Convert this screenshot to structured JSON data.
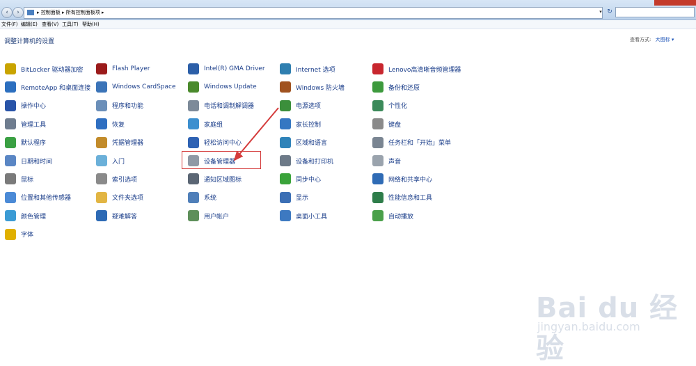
{
  "window": {
    "breadcrumb": [
      "控制面板",
      "所有控制面板项"
    ],
    "search_placeholder": "",
    "menu": [
      "文件(F)",
      "编辑(E)",
      "查看(V)",
      "工具(T)",
      "帮助(H)"
    ]
  },
  "page": {
    "heading": "调整计算机的设置",
    "view_label": "查看方式:",
    "view_value": "大图标 ▾"
  },
  "columns": [
    [
      {
        "label": "BitLocker 驱动器加密",
        "icon": "bitlocker-key-icon",
        "color": "#c9a400"
      },
      {
        "label": "RemoteApp 和桌面连接",
        "icon": "remoteapp-icon",
        "color": "#2c6fbf"
      },
      {
        "label": "操作中心",
        "icon": "action-center-flag-icon",
        "color": "#2954a8"
      },
      {
        "label": "管理工具",
        "icon": "admin-tools-icon",
        "color": "#6f7d8f"
      },
      {
        "label": "默认程序",
        "icon": "default-programs-icon",
        "color": "#3aa043"
      },
      {
        "label": "日期和时间",
        "icon": "clock-icon",
        "color": "#5a86c4"
      },
      {
        "label": "鼠标",
        "icon": "mouse-icon",
        "color": "#7a7a7a"
      },
      {
        "label": "位置和其他传感器",
        "icon": "sensor-icon",
        "color": "#4b8ad6"
      },
      {
        "label": "颜色管理",
        "icon": "color-management-icon",
        "color": "#3b9bd4"
      },
      {
        "label": "字体",
        "icon": "fonts-icon",
        "color": "#e0b000"
      }
    ],
    [
      {
        "label": "Flash Player",
        "icon": "flash-player-icon",
        "color": "#9b1b1b"
      },
      {
        "label": "Windows CardSpace",
        "icon": "cardspace-icon",
        "color": "#3b74b8"
      },
      {
        "label": "程序和功能",
        "icon": "programs-features-icon",
        "color": "#6b8fb9"
      },
      {
        "label": "恢复",
        "icon": "recovery-icon",
        "color": "#2f6fc1"
      },
      {
        "label": "凭据管理器",
        "icon": "credential-manager-icon",
        "color": "#c28b2a"
      },
      {
        "label": "入门",
        "icon": "getting-started-icon",
        "color": "#6bb0d9"
      },
      {
        "label": "索引选项",
        "icon": "indexing-icon",
        "color": "#8a8a8a"
      },
      {
        "label": "文件夹选项",
        "icon": "folder-options-icon",
        "color": "#e2b543"
      },
      {
        "label": "疑难解答",
        "icon": "troubleshooting-icon",
        "color": "#2d6ab5"
      }
    ],
    [
      {
        "label": "Intel(R) GMA Driver",
        "icon": "intel-gma-icon",
        "color": "#2c5fa8"
      },
      {
        "label": "Windows Update",
        "icon": "windows-update-icon",
        "color": "#4a8a2c"
      },
      {
        "label": "电话和调制解调器",
        "icon": "phone-modem-icon",
        "color": "#7d8a99"
      },
      {
        "label": "家庭组",
        "icon": "homegroup-icon",
        "color": "#3c8fcf"
      },
      {
        "label": "轻松访问中心",
        "icon": "ease-of-access-icon",
        "color": "#2e62b3"
      },
      {
        "label": "设备管理器",
        "icon": "device-manager-icon",
        "color": "#8f99a6"
      },
      {
        "label": "通知区域图标",
        "icon": "notification-area-icon",
        "color": "#5b6674"
      },
      {
        "label": "系统",
        "icon": "system-icon",
        "color": "#4f7fb9"
      },
      {
        "label": "用户帐户",
        "icon": "user-accounts-icon",
        "color": "#5e8f5a"
      }
    ],
    [
      {
        "label": "Internet 选项",
        "icon": "internet-options-icon",
        "color": "#2f7fb0"
      },
      {
        "label": "Windows 防火墙",
        "icon": "firewall-icon",
        "color": "#a0521f"
      },
      {
        "label": "电源选项",
        "icon": "power-options-icon",
        "color": "#3b8f3b"
      },
      {
        "label": "家长控制",
        "icon": "parental-controls-icon",
        "color": "#3577c2"
      },
      {
        "label": "区域和语言",
        "icon": "region-language-icon",
        "color": "#2f83b9"
      },
      {
        "label": "设备和打印机",
        "icon": "devices-printers-icon",
        "color": "#6d7a88"
      },
      {
        "label": "同步中心",
        "icon": "sync-center-icon",
        "color": "#3aa33a"
      },
      {
        "label": "显示",
        "icon": "display-icon",
        "color": "#3b6fb5"
      },
      {
        "label": "桌面小工具",
        "icon": "desktop-gadgets-icon",
        "color": "#3d79c1"
      }
    ],
    [
      {
        "label": "Lenovo高清晰音频管理器",
        "icon": "lenovo-audio-icon",
        "color": "#c8262e"
      },
      {
        "label": "备份和还原",
        "icon": "backup-restore-icon",
        "color": "#3d9a3d"
      },
      {
        "label": "个性化",
        "icon": "personalization-icon",
        "color": "#3b8a5a"
      },
      {
        "label": "键盘",
        "icon": "keyboard-icon",
        "color": "#8a8a8a"
      },
      {
        "label": "任务栏和「开始」菜单",
        "icon": "taskbar-start-icon",
        "color": "#7a8592"
      },
      {
        "label": "声音",
        "icon": "sound-icon",
        "color": "#9aa3ad"
      },
      {
        "label": "网络和共享中心",
        "icon": "network-sharing-icon",
        "color": "#2f6bb5"
      },
      {
        "label": "性能信息和工具",
        "icon": "performance-icon",
        "color": "#2e7d4a"
      },
      {
        "label": "自动播放",
        "icon": "autoplay-icon",
        "color": "#4aa04a"
      }
    ]
  ],
  "annotation": {
    "highlighted_item": "设备管理器",
    "arrow_color": "#d43b3b"
  },
  "watermark": {
    "brand": "Bai du 经验",
    "url": "jingyan.baidu.com"
  }
}
